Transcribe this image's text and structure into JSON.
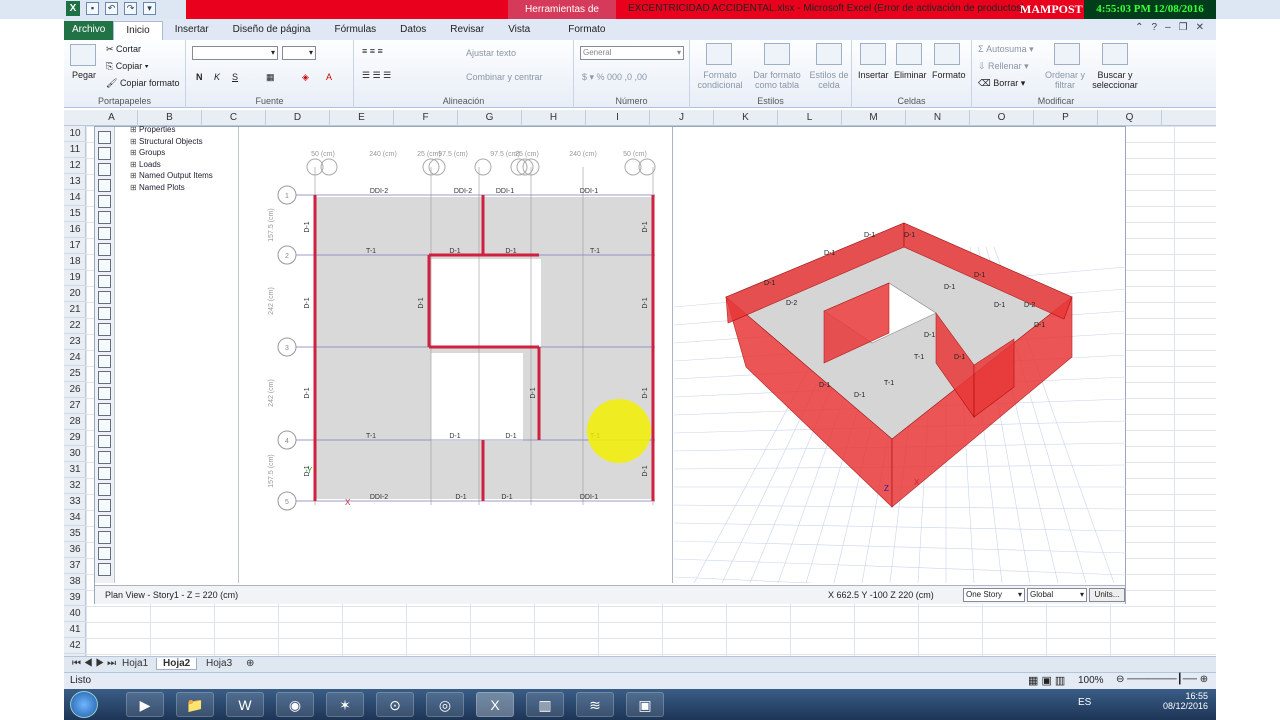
{
  "titlebar": {
    "context_tab": "Herramientas de imagen",
    "document_title": "EXCENTRICIDAD ACCIDENTAL.xlsx - Microsoft Excel (Error de activación de productos)",
    "overlay_text": "MAMPOST",
    "clock": "4:55:03 PM 12/08/2016"
  },
  "tabs": [
    "Archivo",
    "Inicio",
    "Insertar",
    "Diseño de página",
    "Fórmulas",
    "Datos",
    "Revisar",
    "Vista",
    "Formato"
  ],
  "ribbon": {
    "clipboard": {
      "paste": "Pegar",
      "cut": "Cortar",
      "copy": "Copiar",
      "copy_format": "Copiar formato",
      "label": "Portapapeles"
    },
    "font": {
      "bold": "N",
      "italic": "K",
      "underline": "S",
      "label": "Fuente"
    },
    "alignment": {
      "wrap": "Ajustar texto",
      "merge": "Combinar y centrar",
      "label": "Alineación"
    },
    "number": {
      "format": "General",
      "label": "Número"
    },
    "styles": {
      "conditional": "Formato condicional",
      "as_table": "Dar formato como tabla",
      "cell_styles": "Estilos de celda",
      "label": "Estilos"
    },
    "cells": {
      "insert": "Insertar",
      "delete": "Eliminar",
      "format": "Formato",
      "label": "Celdas"
    },
    "editing": {
      "autosum": "Autosuma",
      "fill": "Rellenar",
      "clear": "Borrar",
      "sort": "Ordenar y filtrar",
      "find": "Buscar y seleccionar",
      "label": "Modificar"
    }
  },
  "columns": [
    "A",
    "B",
    "C",
    "D",
    "E",
    "F",
    "G",
    "H",
    "I",
    "J",
    "K",
    "L",
    "M",
    "N",
    "O",
    "P",
    "Q"
  ],
  "rows": [
    "10",
    "11",
    "12",
    "13",
    "14",
    "15",
    "16",
    "17",
    "18",
    "19",
    "20",
    "21",
    "22",
    "23",
    "24",
    "25",
    "26",
    "27",
    "28",
    "29",
    "30",
    "31",
    "32",
    "33",
    "34",
    "35",
    "36",
    "37",
    "38",
    "39",
    "40",
    "41",
    "42"
  ],
  "etabs": {
    "tree": [
      "Properties",
      "Structural Objects",
      "Groups",
      "Loads",
      "Named Output Items",
      "Named Plots"
    ],
    "plan_status": "Plan View - Story1 - Z = 220 (cm)",
    "coords": "X 662.5  Y -100  Z 220 (cm)",
    "story_option": "One Story",
    "system_option": "Global",
    "units_button": "Units...",
    "plan": {
      "dims_top": [
        "50 (cm)",
        "240 (cm)",
        "25 (cm)",
        "97.5 (cm)",
        "97.5 (cm)",
        "25 (cm)",
        "240 (cm)",
        "50 (cm)"
      ],
      "dims_left": [
        "157.5 (cm)",
        "242 (cm)",
        "242 (cm)",
        "157.5 (cm)"
      ],
      "grid_numbers": [
        "1",
        "2",
        "3",
        "4",
        "5"
      ],
      "top_labels": [
        "DDI-2",
        "DDI-2",
        "DDI-1",
        "DDI-1"
      ],
      "bottom_labels": [
        "DDI-2",
        "D-1",
        "D-1",
        "DDI-1"
      ],
      "beams": [
        "T-1",
        "D-1",
        "D-1",
        "T-1",
        "T-1",
        "D-1",
        "D-1",
        "T-1"
      ],
      "walls": [
        "D-1",
        "D-1",
        "D-1",
        "D-1",
        "D-1",
        "D-1",
        "D-1",
        "D-1",
        "D-1",
        "D-1"
      ],
      "axis_x": "X",
      "axis_y": "Y"
    },
    "model3d": {
      "labels": [
        "D-1",
        "D-1",
        "D-1",
        "D-1",
        "D-2",
        "T-1",
        "D-1",
        "D-1",
        "T-1",
        "D-1",
        "D-1",
        "D-1",
        "D-2",
        "D-1",
        "D-1",
        "D-1"
      ],
      "axis_z": "Z",
      "axis_x": "X"
    }
  },
  "sheets": [
    "Hoja1",
    "Hoja2",
    "Hoja3"
  ],
  "status": {
    "ready": "Listo",
    "zoom": "100%"
  },
  "taskbar": {
    "lang": "ES",
    "time": "16:55",
    "date": "08/12/2016"
  },
  "colors": {
    "accent_red": "#e8001c",
    "excel_green": "#217346",
    "wall_red": "#e03030"
  }
}
